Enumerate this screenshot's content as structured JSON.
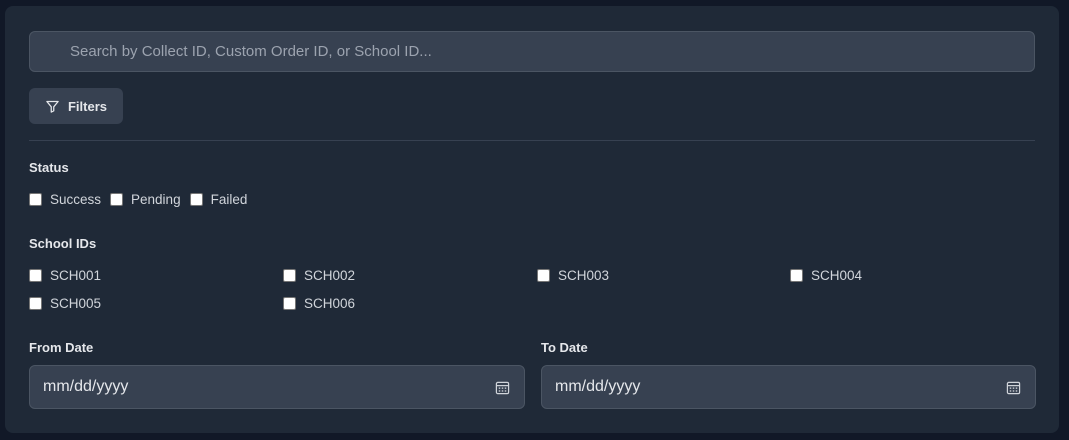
{
  "search": {
    "placeholder": "Search by Collect ID, Custom Order ID, or School ID..."
  },
  "filters_button": {
    "label": "Filters",
    "icon": "filter-icon"
  },
  "status": {
    "label": "Status",
    "options": [
      {
        "label": "Success",
        "checked": false
      },
      {
        "label": "Pending",
        "checked": false
      },
      {
        "label": "Failed",
        "checked": false
      }
    ]
  },
  "school_ids": {
    "label": "School IDs",
    "options": [
      {
        "label": "SCH001",
        "checked": false
      },
      {
        "label": "SCH002",
        "checked": false
      },
      {
        "label": "SCH003",
        "checked": false
      },
      {
        "label": "SCH004",
        "checked": false
      },
      {
        "label": "SCH005",
        "checked": false
      },
      {
        "label": "SCH006",
        "checked": false
      }
    ]
  },
  "from_date": {
    "label": "From Date",
    "value": "mm/dd/yyyy",
    "icon": "calendar-icon"
  },
  "to_date": {
    "label": "To Date",
    "value": "mm/dd/yyyy",
    "icon": "calendar-icon"
  },
  "colors": {
    "background": "#111827",
    "panel": "#1f2937",
    "input": "#374151",
    "text": "#e5e7eb"
  }
}
